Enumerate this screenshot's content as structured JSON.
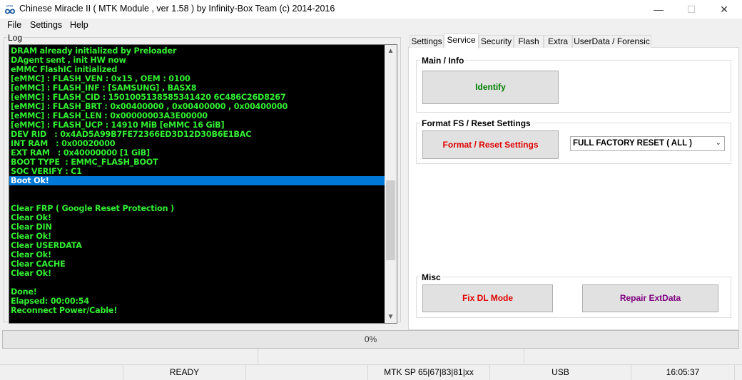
{
  "window": {
    "title": "Chinese Miracle II ( MTK Module , ver 1.58 ) by Infinity-Box Team (c) 2014-2016",
    "icon_text": "MTK",
    "minimize": "—",
    "maximize": "☐",
    "close": "✕"
  },
  "menu": [
    "File",
    "Settings",
    "Help"
  ],
  "log": {
    "label": "Log",
    "lines": [
      "DRAM already initialized by Preloader",
      "DAgent sent , init HW now",
      "eMMC FlashIC initialized",
      "[eMMC] : FLASH_VEN : 0x15 , OEM : 0100",
      "[eMMC] : FLASH_INF : [SAMSUNG] , BASX8",
      "[eMMC] : FLASH_CID : 1501005138585341420 6C486C26D8267",
      "[eMMC] : FLASH_BRT : 0x00400000 , 0x00400000 , 0x00400000",
      "[eMMC] : FLASH_LEN : 0x00000003A3E00000",
      "[eMMC] : FLASH_UCP : 14910 MiB [eMMC 16 GiB]",
      "DEV RID   : 0x4AD5A99B7FE72366ED3D12D30B6E1BAC",
      "INT RAM   : 0x00020000",
      "EXT RAM   : 0x40000000 [1 GiB]",
      "BOOT TYPE  : EMMC_FLASH_BOOT",
      "SOC VERIFY : C1",
      "Boot Ok!",
      "",
      "",
      "Clear FRP ( Google Reset Protection )",
      "Clear Ok!",
      "Clear DIN",
      "Clear Ok!",
      "Clear USERDATA",
      "Clear Ok!",
      "Clear CACHE",
      "Clear Ok!",
      "",
      "Done!",
      "Elapsed: 00:00:54",
      "Reconnect Power/Cable!"
    ],
    "selected_index": 14,
    "scroll_up": "▲",
    "scroll_down": "▼"
  },
  "tabs": [
    "Settings",
    "Service",
    "Security",
    "Flash",
    "Extra",
    "UserData / Forensic"
  ],
  "active_tab": "Service",
  "service": {
    "main_info": {
      "title": "Main / Info",
      "identify_label": "Identify",
      "identify_color": "#008000"
    },
    "format": {
      "title": "Format FS / Reset Settings",
      "button_label": "Format / Reset Settings",
      "button_color": "#e00000",
      "combo_value": "FULL FACTORY RESET ( ALL )",
      "combo_chevron": "⌄"
    },
    "misc": {
      "title": "Misc",
      "fix_dl_label": "Fix DL Mode",
      "fix_dl_color": "#e00000",
      "repair_label": "Repair ExtData",
      "repair_color": "#800080"
    }
  },
  "progress": {
    "text": "0%",
    "value": 0
  },
  "status": {
    "state": "READY",
    "platform": "MTK SP 65|67|83|81|xx",
    "connection": "USB",
    "time": "16:05:37"
  },
  "colors": {
    "log_text": "#33ee33",
    "log_bg": "#000000",
    "selection": "#0078d7"
  }
}
